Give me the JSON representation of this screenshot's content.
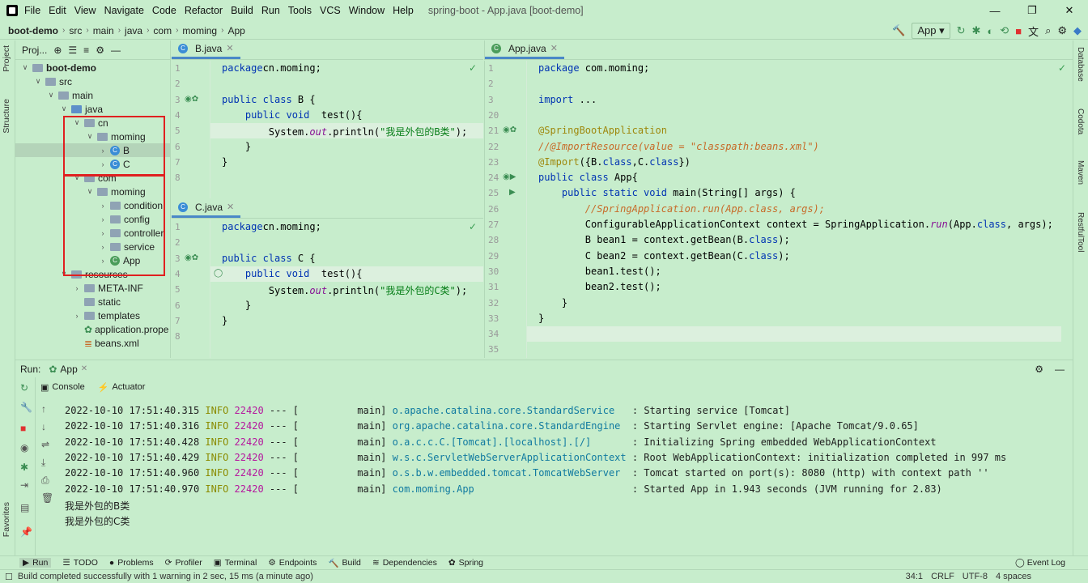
{
  "menu": {
    "items": [
      "File",
      "Edit",
      "View",
      "Navigate",
      "Code",
      "Refactor",
      "Build",
      "Run",
      "Tools",
      "VCS",
      "Window",
      "Help"
    ],
    "title": "spring-boot - App.java [boot-demo]"
  },
  "nav": {
    "crumbs": [
      "boot-demo",
      "src",
      "main",
      "java",
      "com",
      "moming",
      "App"
    ],
    "run_config": "App"
  },
  "left_strip": {
    "project": "Project",
    "structure": "Structure",
    "favorites": "Favorites"
  },
  "right_strip": {
    "database": "Database",
    "codota": "Codota",
    "maven": "Maven",
    "restful": "RestfulTool"
  },
  "project": {
    "header": "Proj...",
    "tree": [
      {
        "label": "boot-demo",
        "depth": 0,
        "icon": "folder",
        "bold": true
      },
      {
        "label": "src",
        "depth": 1,
        "icon": "folder"
      },
      {
        "label": "main",
        "depth": 2,
        "icon": "folder"
      },
      {
        "label": "java",
        "depth": 3,
        "icon": "folder-blue"
      },
      {
        "label": "cn",
        "depth": 4,
        "icon": "folder"
      },
      {
        "label": "moming",
        "depth": 5,
        "icon": "folder"
      },
      {
        "label": "B",
        "depth": 6,
        "icon": "class",
        "selected": true
      },
      {
        "label": "C",
        "depth": 6,
        "icon": "class"
      },
      {
        "label": "com",
        "depth": 4,
        "icon": "folder"
      },
      {
        "label": "moming",
        "depth": 5,
        "icon": "folder"
      },
      {
        "label": "condition",
        "depth": 6,
        "icon": "folder"
      },
      {
        "label": "config",
        "depth": 6,
        "icon": "folder"
      },
      {
        "label": "controller",
        "depth": 6,
        "icon": "folder"
      },
      {
        "label": "service",
        "depth": 6,
        "icon": "folder"
      },
      {
        "label": "App",
        "depth": 6,
        "icon": "spring-class"
      },
      {
        "label": "resources",
        "depth": 3,
        "icon": "folder"
      },
      {
        "label": "META-INF",
        "depth": 4,
        "icon": "folder"
      },
      {
        "label": "static",
        "depth": 4,
        "icon": "folder"
      },
      {
        "label": "templates",
        "depth": 4,
        "icon": "folder"
      },
      {
        "label": "application.prope",
        "depth": 4,
        "icon": "props"
      },
      {
        "label": "beans.xml",
        "depth": 4,
        "icon": "xml"
      }
    ]
  },
  "editor_b": {
    "tab": "B.java",
    "lines": [
      "1",
      "2",
      "3",
      "4",
      "5",
      "6",
      "7",
      "8"
    ],
    "code": [
      [
        [
          "kw",
          "package"
        ],
        [
          "",
          "cn.moming;"
        ]
      ],
      [],
      [
        [
          "kw",
          "public class"
        ],
        [
          "",
          " B {"
        ]
      ],
      [
        [
          "",
          "    "
        ],
        [
          "kw",
          "public void"
        ],
        [
          "",
          "  test(){"
        ]
      ],
      [
        [
          "",
          "        System."
        ],
        [
          "it",
          "out"
        ],
        [
          "",
          ".println("
        ],
        [
          "st",
          "\"我是外包的B类\""
        ],
        [
          "",
          ");"
        ]
      ],
      [
        [
          "",
          "    }"
        ]
      ],
      [
        [
          "",
          "}"
        ]
      ],
      []
    ]
  },
  "editor_c": {
    "tab": "C.java",
    "lines": [
      "1",
      "2",
      "3",
      "4",
      "5",
      "6",
      "7",
      "8"
    ],
    "code": [
      [
        [
          "kw",
          "package"
        ],
        [
          "",
          "cn.moming;"
        ]
      ],
      [],
      [
        [
          "kw",
          "public class"
        ],
        [
          "",
          " C {"
        ]
      ],
      [
        [
          "",
          "    "
        ],
        [
          "kw",
          "public void"
        ],
        [
          "",
          "  test(){"
        ]
      ],
      [
        [
          "",
          "        System."
        ],
        [
          "it",
          "out"
        ],
        [
          "",
          ".println("
        ],
        [
          "st",
          "\"我是外包的C类\""
        ],
        [
          "",
          ");"
        ]
      ],
      [
        [
          "",
          "    }"
        ]
      ],
      [
        [
          "",
          "}"
        ]
      ],
      []
    ]
  },
  "editor_app": {
    "tab": "App.java",
    "lines": [
      "1",
      "2",
      "3",
      "20",
      "21",
      "22",
      "23",
      "24",
      "25",
      "26",
      "27",
      "28",
      "29",
      "30",
      "31",
      "32",
      "33",
      "34",
      "35"
    ],
    "code": [
      [
        [
          "kw",
          "package"
        ],
        [
          "",
          " com.moming;"
        ]
      ],
      [],
      [
        [
          "kw",
          "import"
        ],
        [
          "",
          " ..."
        ]
      ],
      [],
      [
        [
          "an",
          "@SpringBootApplication"
        ]
      ],
      [
        [
          "cm",
          "//@ImportResource(value = \"classpath:beans.xml\")"
        ]
      ],
      [
        [
          "an",
          "@Import"
        ],
        [
          "",
          "({B."
        ],
        [
          "kw",
          "class"
        ],
        [
          "",
          ",C."
        ],
        [
          "kw",
          "class"
        ],
        [
          "",
          "})"
        ]
      ],
      [
        [
          "kw",
          "public class"
        ],
        [
          "",
          " App{"
        ]
      ],
      [
        [
          "",
          "    "
        ],
        [
          "kw",
          "public static void"
        ],
        [
          "",
          " main(String[] args) {"
        ]
      ],
      [
        [
          "cm",
          "        //SpringApplication.run(App.class, args);"
        ]
      ],
      [
        [
          "",
          "        ConfigurableApplicationContext context = SpringApplication."
        ],
        [
          "it",
          "run"
        ],
        [
          "",
          "(App."
        ],
        [
          "kw",
          "class"
        ],
        [
          "",
          ", args);"
        ]
      ],
      [
        [
          "",
          "        B bean1 = context.getBean(B."
        ],
        [
          "kw",
          "class"
        ],
        [
          "",
          ");"
        ]
      ],
      [
        [
          "",
          "        C bean2 = context.getBean(C."
        ],
        [
          "kw",
          "class"
        ],
        [
          "",
          ");"
        ]
      ],
      [
        [
          "",
          "        bean1.test();"
        ]
      ],
      [
        [
          "",
          "        bean2.test();"
        ]
      ],
      [
        [
          "",
          "    }"
        ]
      ],
      [
        [
          "",
          "}"
        ]
      ],
      [],
      []
    ]
  },
  "run": {
    "label": "Run:",
    "tab": "App",
    "console_tab": "Console",
    "actuator_tab": "Actuator",
    "logs": [
      {
        "ts": "2022-10-10 17:51:40.315",
        "level": "INFO",
        "pid": "22420",
        "sep": "--- [",
        "thread": "main]",
        "logger": "o.apache.catalina.core.StandardService",
        "msg": ": Starting service [Tomcat]"
      },
      {
        "ts": "2022-10-10 17:51:40.316",
        "level": "INFO",
        "pid": "22420",
        "sep": "--- [",
        "thread": "main]",
        "logger": "org.apache.catalina.core.StandardEngine",
        "msg": ": Starting Servlet engine: [Apache Tomcat/9.0.65]"
      },
      {
        "ts": "2022-10-10 17:51:40.428",
        "level": "INFO",
        "pid": "22420",
        "sep": "--- [",
        "thread": "main]",
        "logger": "o.a.c.c.C.[Tomcat].[localhost].[/]",
        "msg": ": Initializing Spring embedded WebApplicationContext"
      },
      {
        "ts": "2022-10-10 17:51:40.429",
        "level": "INFO",
        "pid": "22420",
        "sep": "--- [",
        "thread": "main]",
        "logger": "w.s.c.ServletWebServerApplicationContext",
        "msg": ": Root WebApplicationContext: initialization completed in 997 ms"
      },
      {
        "ts": "2022-10-10 17:51:40.960",
        "level": "INFO",
        "pid": "22420",
        "sep": "--- [",
        "thread": "main]",
        "logger": "o.s.b.w.embedded.tomcat.TomcatWebServer",
        "msg": ": Tomcat started on port(s): 8080 (http) with context path ''"
      },
      {
        "ts": "2022-10-10 17:51:40.970",
        "level": "INFO",
        "pid": "22420",
        "sep": "--- [",
        "thread": "main]",
        "logger": "com.moming.App",
        "msg": ": Started App in 1.943 seconds (JVM running for 2.83)"
      }
    ],
    "output": [
      "我是外包的B类",
      "我是外包的C类"
    ]
  },
  "toolwindows": [
    "Run",
    "TODO",
    "Problems",
    "Profiler",
    "Terminal",
    "Endpoints",
    "Build",
    "Dependencies",
    "Spring"
  ],
  "event_log": "Event Log",
  "status": {
    "message": "Build completed successfully with 1 warning in 2 sec, 15 ms (a minute ago)",
    "position": "34:1",
    "line_sep": "CRLF",
    "encoding": "UTF-8",
    "indent": "4 spaces"
  }
}
